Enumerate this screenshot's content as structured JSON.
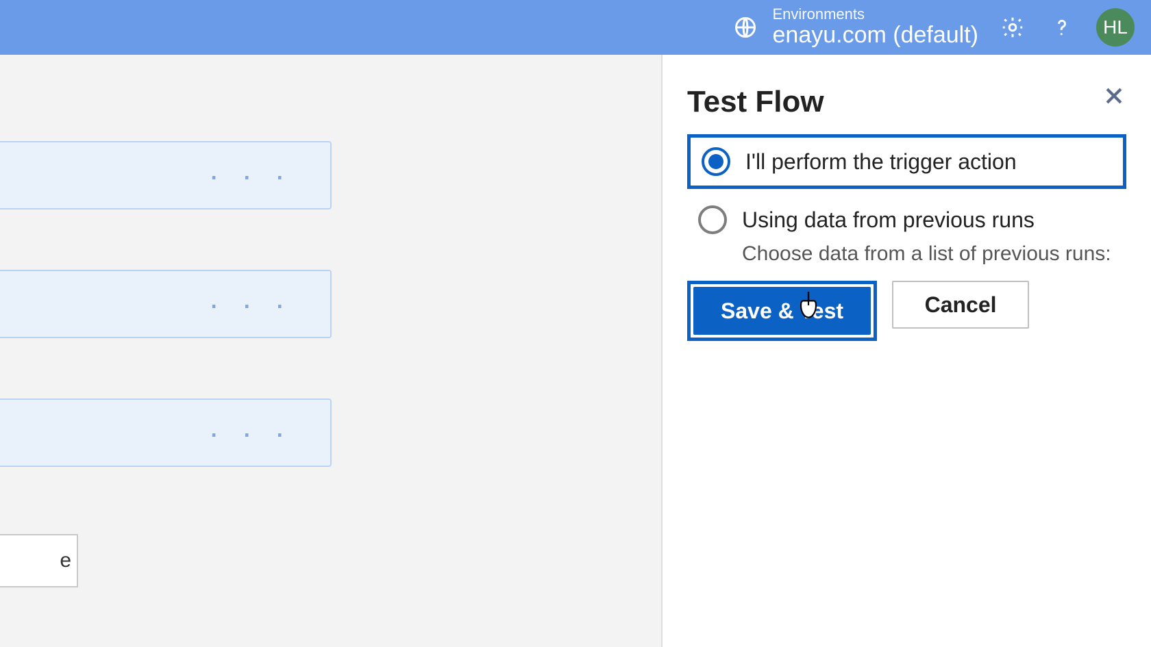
{
  "header": {
    "environments_label": "Environments",
    "environment_name": "enayu.com (default)",
    "avatar_initials": "HL"
  },
  "canvas": {
    "ellipsis": "· · ·",
    "small_card_text": "e"
  },
  "panel": {
    "title": "Test Flow",
    "option_perform": "I'll perform the trigger action",
    "option_previous": "Using data from previous runs",
    "previous_desc": "Choose data from a list of previous runs:",
    "save_test_label": "Save & Test",
    "cancel_label": "Cancel"
  }
}
